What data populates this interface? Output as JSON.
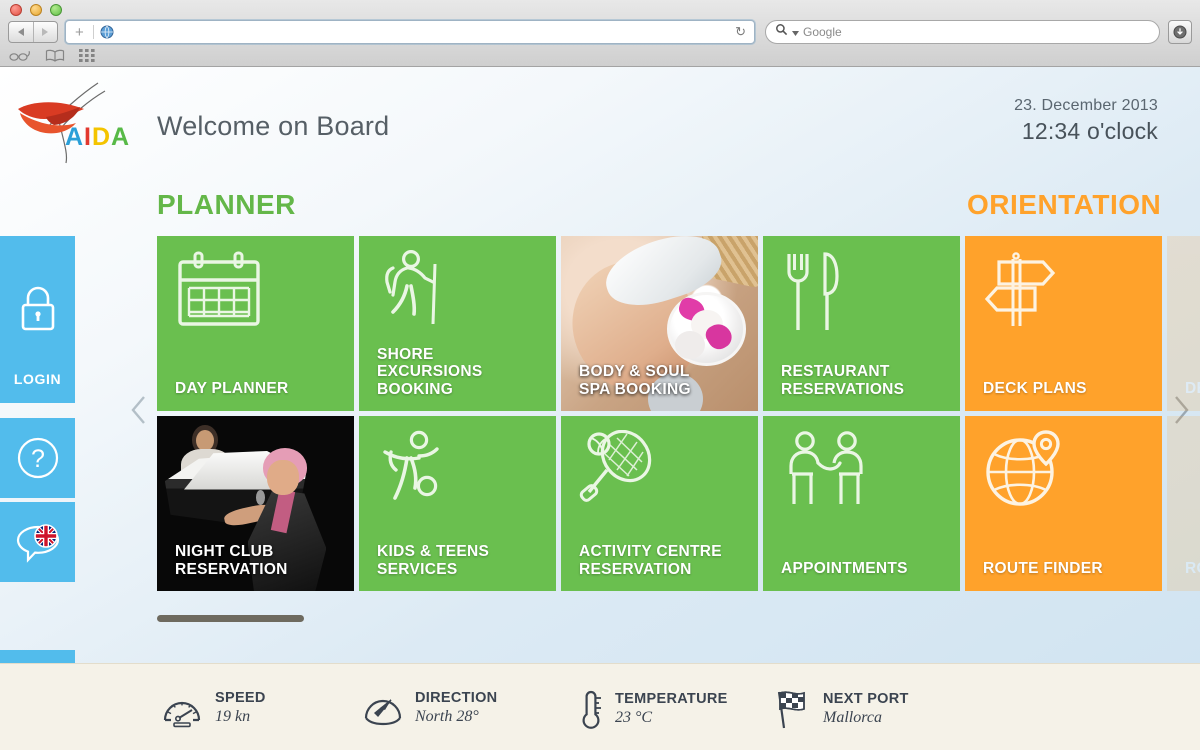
{
  "browser": {
    "url_value": "",
    "plus_label": "+",
    "reload_icon": "reload-icon",
    "search_placeholder": "Google",
    "downloads_icon": "downloads-icon",
    "bookmarks": [
      "reader-icon",
      "bookmarks-icon",
      "top-sites-icon"
    ]
  },
  "header": {
    "brand": "AIDA",
    "brand_letters": [
      {
        "char": "A",
        "color": "#2a9fd8"
      },
      {
        "char": "I",
        "color": "#e2382f"
      },
      {
        "char": "D",
        "color": "#f4c400"
      },
      {
        "char": "A",
        "color": "#57b947"
      }
    ],
    "title": "Welcome on Board",
    "date": "23. December 2013",
    "time": "12:34 o'clock"
  },
  "sections": {
    "planner": {
      "label": "PLANNER",
      "color": "#64b749"
    },
    "orientation": {
      "label": "ORIENTATION",
      "color": "#ffa22b"
    }
  },
  "sidebar": {
    "items": [
      {
        "name": "login",
        "label": "LOGIN",
        "icon": "padlock-icon"
      },
      {
        "name": "help",
        "label": "",
        "icon": "question-mark-icon"
      },
      {
        "name": "language",
        "label": "",
        "icon": "speech-bubble-uk-flag-icon"
      },
      {
        "name": "radio",
        "label": "",
        "icon": "broadcast-signal-icon"
      }
    ]
  },
  "carousel": {
    "prev_label": "previous",
    "next_label": "next",
    "scroll_position": 0
  },
  "tiles": {
    "row1": [
      {
        "label": "DAY PLANNER",
        "style": "green",
        "icon": "calendar-icon"
      },
      {
        "label": "SHORE\nEXCURSIONS\nBOOKING",
        "style": "green",
        "icon": "hiker-icon"
      },
      {
        "label": "BODY & SOUL\nSPA BOOKING",
        "style": "photo",
        "icon": "spa-photo"
      },
      {
        "label": "RESTAURANT\nRESERVATIONS",
        "style": "green",
        "icon": "fork-knife-icon"
      },
      {
        "label": "DECK PLANS",
        "style": "orange",
        "icon": "signpost-icon"
      }
    ],
    "row2": [
      {
        "label": "NIGHT CLUB\nRESERVATION",
        "style": "photo",
        "icon": "night-club-photo"
      },
      {
        "label": "KIDS & TEENS\nSERVICES",
        "style": "green",
        "icon": "soccer-player-icon"
      },
      {
        "label": "ACTIVITY CENTRE\nRESERVATION",
        "style": "green",
        "icon": "tennis-racket-icon"
      },
      {
        "label": "APPOINTMENTS",
        "style": "green",
        "icon": "two-people-handshake-icon"
      },
      {
        "label": "ROUTE FINDER",
        "style": "orange",
        "icon": "globe-pin-icon"
      }
    ],
    "ghost": [
      {
        "label": "DE",
        "style": "orange"
      },
      {
        "label": "RO",
        "style": "orange"
      }
    ]
  },
  "status": [
    {
      "name": "speed",
      "label": "SPEED",
      "value": "19 kn",
      "icon": "speedometer-icon"
    },
    {
      "name": "direction",
      "label": "DIRECTION",
      "value": "North 28°",
      "icon": "compass-icon"
    },
    {
      "name": "temperature",
      "label": "TEMPERATURE",
      "value": "23 °C",
      "icon": "thermometer-icon"
    },
    {
      "name": "next-port",
      "label": "NEXT PORT",
      "value": "Mallorca",
      "icon": "checkered-flag-icon"
    }
  ],
  "colors": {
    "green": "#6abf4f",
    "orange": "#ffa22b",
    "blue": "#52bcec",
    "status_bg": "#f5f2e8"
  }
}
